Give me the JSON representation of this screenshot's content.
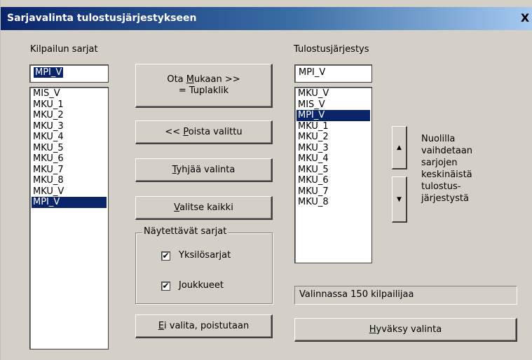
{
  "window": {
    "title": "Sarjavalinta tulostusjärjestykseen",
    "close_label": "X"
  },
  "left": {
    "label": "Kilpailun sarjat",
    "input_value": "MPI_V",
    "items": [
      "MIS_V",
      "MKU_1",
      "MKU_2",
      "MKU_3",
      "MKU_4",
      "MKU_5",
      "MKU_6",
      "MKU_7",
      "MKU_8",
      "MKU_V",
      "MPI_V"
    ],
    "selected": "MPI_V"
  },
  "buttons": {
    "add_pre": "Ota ",
    "add_ul": "M",
    "add_post": "ukaan  >>",
    "add_line2": "= Tuplaklik",
    "remove_pre": "<< ",
    "remove_ul": "P",
    "remove_post": "oista valittu",
    "clear_ul": "T",
    "clear_post": "yhjää valinta",
    "all_ul": "V",
    "all_post": "alitse kaikki",
    "cancel_ul": "E",
    "cancel_post": "i valita, poistutaan",
    "accept_ul": "H",
    "accept_post": "yväksy valinta"
  },
  "group": {
    "label": "Näytettävät sarjat",
    "option1": "Yksilösarjat",
    "option1_checked": true,
    "option2": "Joukkueet",
    "option2_checked": true,
    "check_mark": "✔"
  },
  "right": {
    "label": "Tulostusjärjestys",
    "input_value": "MPI_V",
    "items": [
      "MKU_V",
      "MIS_V",
      "MPI_V",
      "MKU_1",
      "MKU_2",
      "MKU_3",
      "MKU_4",
      "MKU_5",
      "MKU_6",
      "MKU_7",
      "MKU_8"
    ],
    "selected": "MPI_V"
  },
  "order": {
    "up_icon": "▲",
    "down_icon": "▼",
    "hint": "Nuolilla\nvaihdetaan\nsarjojen\nkeskinäistä\ntulostus-\njärjestystä"
  },
  "status": "Valinnassa 150 kilpailijaa"
}
